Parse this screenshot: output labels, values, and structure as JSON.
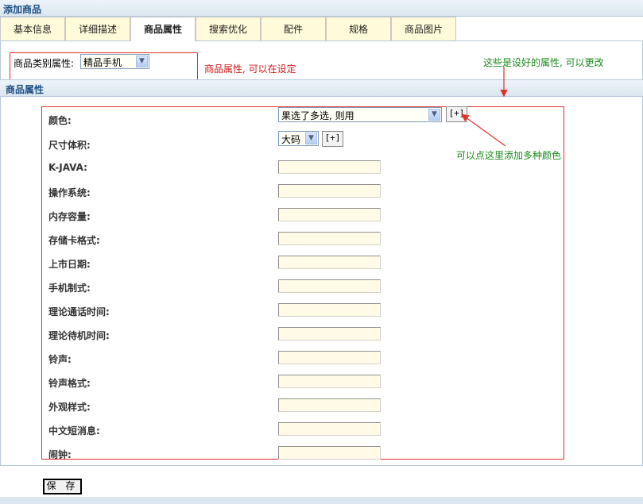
{
  "header": {
    "title": "添加商品"
  },
  "tabs": [
    "基本信息",
    "详细描述",
    "商品属性",
    "搜索优化",
    "配件",
    "规格",
    "商品图片"
  ],
  "active_tab": "商品属性",
  "category": {
    "label": "商品类别属性:",
    "selected": "精品手机"
  },
  "notes": {
    "category_note": "商品属性, 可以在设定",
    "preset_note": "这些是设好的属性, 可以更改",
    "add_color_note": "可以点这里添加多种颜色"
  },
  "section": {
    "title": "商品属性"
  },
  "color": {
    "label": "颜色:",
    "selected": "果选了多选, 则用",
    "add_label": "[+]"
  },
  "size": {
    "label": "尺寸体积:",
    "selected": "大码",
    "add_label": "[+]"
  },
  "attributes": [
    "K-JAVA:",
    "操作系统:",
    "内存容量:",
    "存储卡格式:",
    "上市日期:",
    "手机制式:",
    "理论通话时间:",
    "理论待机时间:",
    "铃声:",
    "铃声格式:",
    "外观样式:",
    "中文短消息:",
    "闹钟:"
  ],
  "actions": {
    "save_label": "保 存"
  },
  "colors": {
    "accent": "#1d4f86",
    "annotation_red": "#e1322c",
    "annotation_green": "#1a8a1a",
    "input_bg": "#fffbe6"
  }
}
